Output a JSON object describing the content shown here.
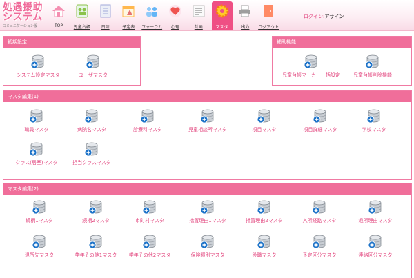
{
  "app": {
    "logo_line1": "処遇援助",
    "logo_line2": "システム",
    "logo_sub": "コミュニケーション版"
  },
  "nav": [
    {
      "label": "TOP",
      "icon": "house-icon",
      "color": "#f48fb1"
    },
    {
      "label": "児童台帳",
      "icon": "children-icon",
      "color": "#8bc34a"
    },
    {
      "label": "日誌",
      "icon": "notebook-icon",
      "color": "#9fa8da"
    },
    {
      "label": "予定表",
      "icon": "calendar-icon",
      "color": "#ffb74d"
    },
    {
      "label": "フォーラム",
      "icon": "people-icon",
      "color": "#90caf9"
    },
    {
      "label": "心理",
      "icon": "heart-icon",
      "color": "#ef5350"
    },
    {
      "label": "計画",
      "icon": "plan-icon",
      "color": "#bdbdbd"
    },
    {
      "label": "マスタ",
      "icon": "gear-icon",
      "color": "#ffca28",
      "active": true
    },
    {
      "label": "出力",
      "icon": "printer-icon",
      "color": "#9e9e9e"
    },
    {
      "label": "ログアウト",
      "icon": "door-icon",
      "color": "#ff8a65"
    }
  ],
  "login": {
    "prefix": "ログイン:",
    "user": "アサイン"
  },
  "panels": {
    "initial": {
      "title": "初期設定",
      "items": [
        "システム設定マスタ",
        "ユーザマスタ"
      ]
    },
    "support": {
      "title": "補助機能",
      "items": [
        "児童台帳マーカー一括設定",
        "児童台帳削除機能"
      ]
    },
    "master1": {
      "title": "マスタ編集(1)",
      "items": [
        "職員マスタ",
        "病院名マスタ",
        "診療科マスタ",
        "児童相談所マスタ",
        "項目マスタ",
        "項目詳細マスタ",
        "学校マスタ",
        "クラス(居室)マスタ",
        "担当クラスマスタ"
      ]
    },
    "master2": {
      "title": "マスタ編集(2)",
      "items": [
        "続柄1マスタ",
        "続柄2マスタ",
        "市町村マスタ",
        "措置理由1マスタ",
        "措置理由2マスタ",
        "入所経路マスタ",
        "退所理由マスタ",
        "退所先マスタ",
        "学年その他1マスタ",
        "学年その他2マスタ",
        "保険種別マスタ",
        "役職マスタ",
        "予定区分マスタ",
        "連絡区分マスタ"
      ]
    }
  },
  "colors": {
    "accent": "#f06e9a",
    "link": "#e2447d",
    "db_icon": "#9aa0a8",
    "plus_icon": "#1e73c8"
  }
}
